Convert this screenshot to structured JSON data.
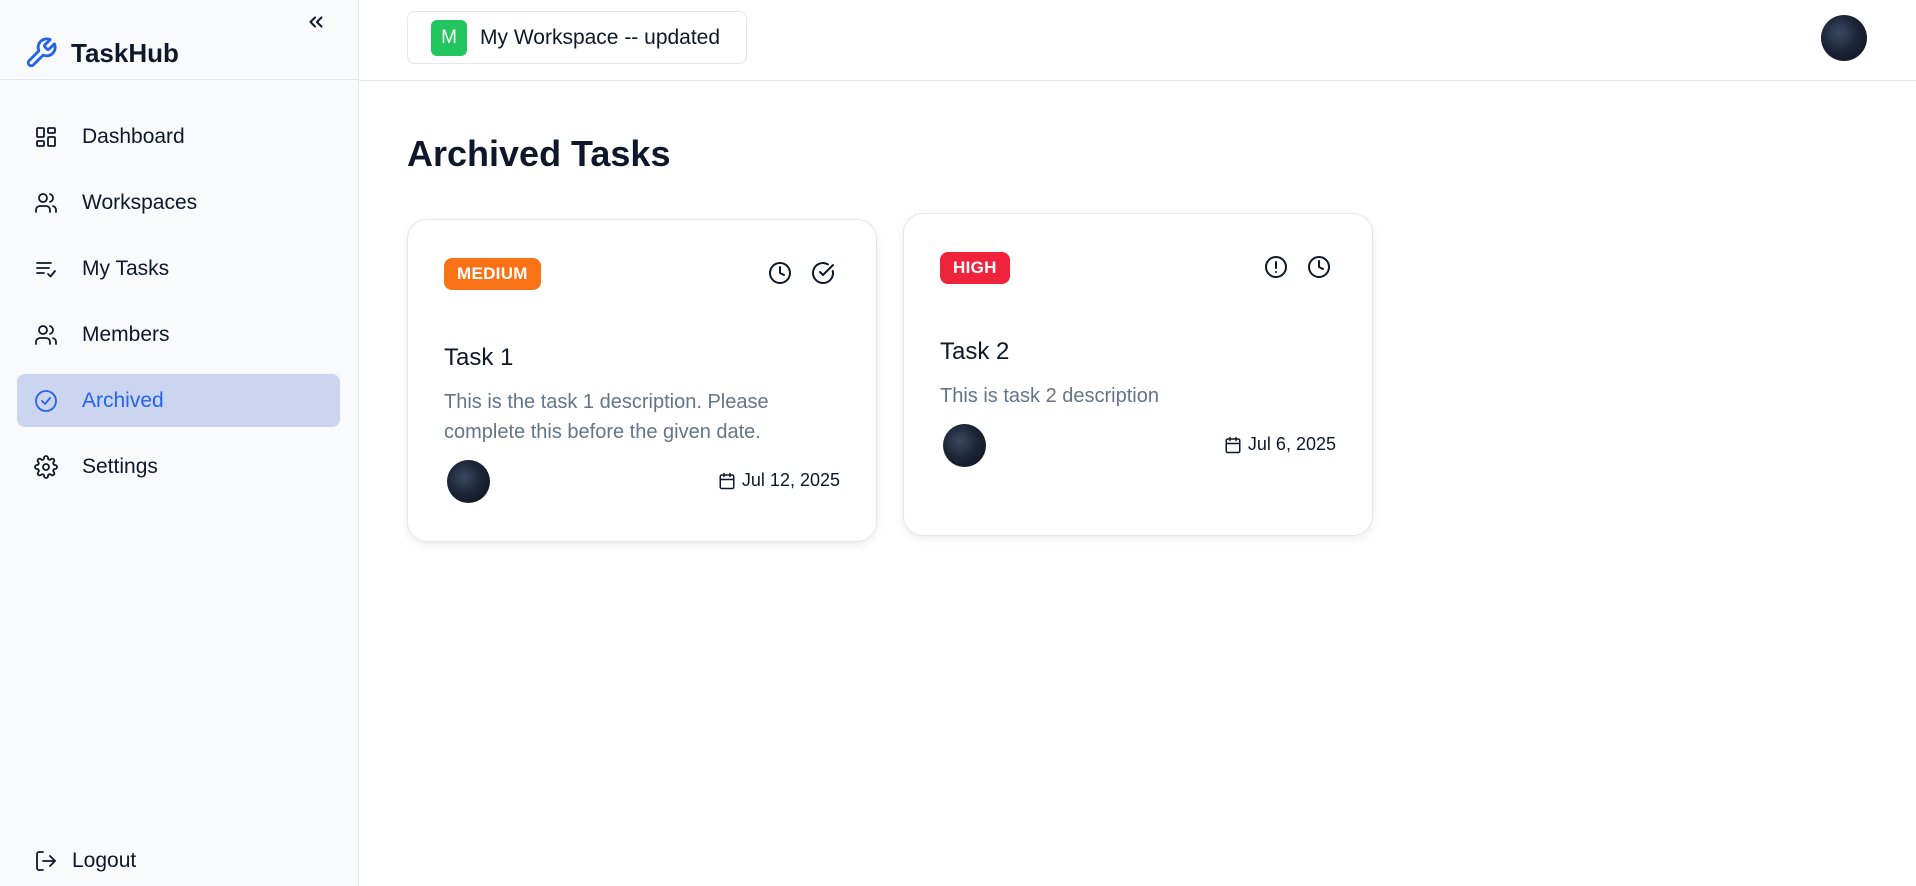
{
  "app": {
    "name": "TaskHub"
  },
  "sidebar": {
    "items": [
      {
        "label": "Dashboard",
        "icon": "layout-dashboard-icon"
      },
      {
        "label": "Workspaces",
        "icon": "users-icon"
      },
      {
        "label": "My Tasks",
        "icon": "list-checks-icon"
      },
      {
        "label": "Members",
        "icon": "users-icon"
      },
      {
        "label": "Archived",
        "icon": "check-circle-icon",
        "active": true
      },
      {
        "label": "Settings",
        "icon": "gear-icon"
      }
    ],
    "logout_label": "Logout"
  },
  "header": {
    "workspace_initial": "M",
    "workspace_name": "My Workspace -- updated",
    "workspace_color": "#22c55e"
  },
  "page": {
    "title": "Archived Tasks"
  },
  "tasks": [
    {
      "priority": "MEDIUM",
      "priority_color": "#f97316",
      "status_icons": [
        "clock-icon",
        "check-circle-icon"
      ],
      "title": "Task 1",
      "description": "This is the task 1 description. Please complete this before the given date.",
      "due_date": "Jul 12, 2025"
    },
    {
      "priority": "HIGH",
      "priority_color": "#ef233c",
      "status_icons": [
        "alert-circle-icon",
        "clock-icon"
      ],
      "title": "Task 2",
      "description": "This is task 2 description",
      "due_date": "Jul 6, 2025"
    }
  ],
  "colors": {
    "accent": "#2563eb",
    "active_bg": "#cbd5f0"
  }
}
